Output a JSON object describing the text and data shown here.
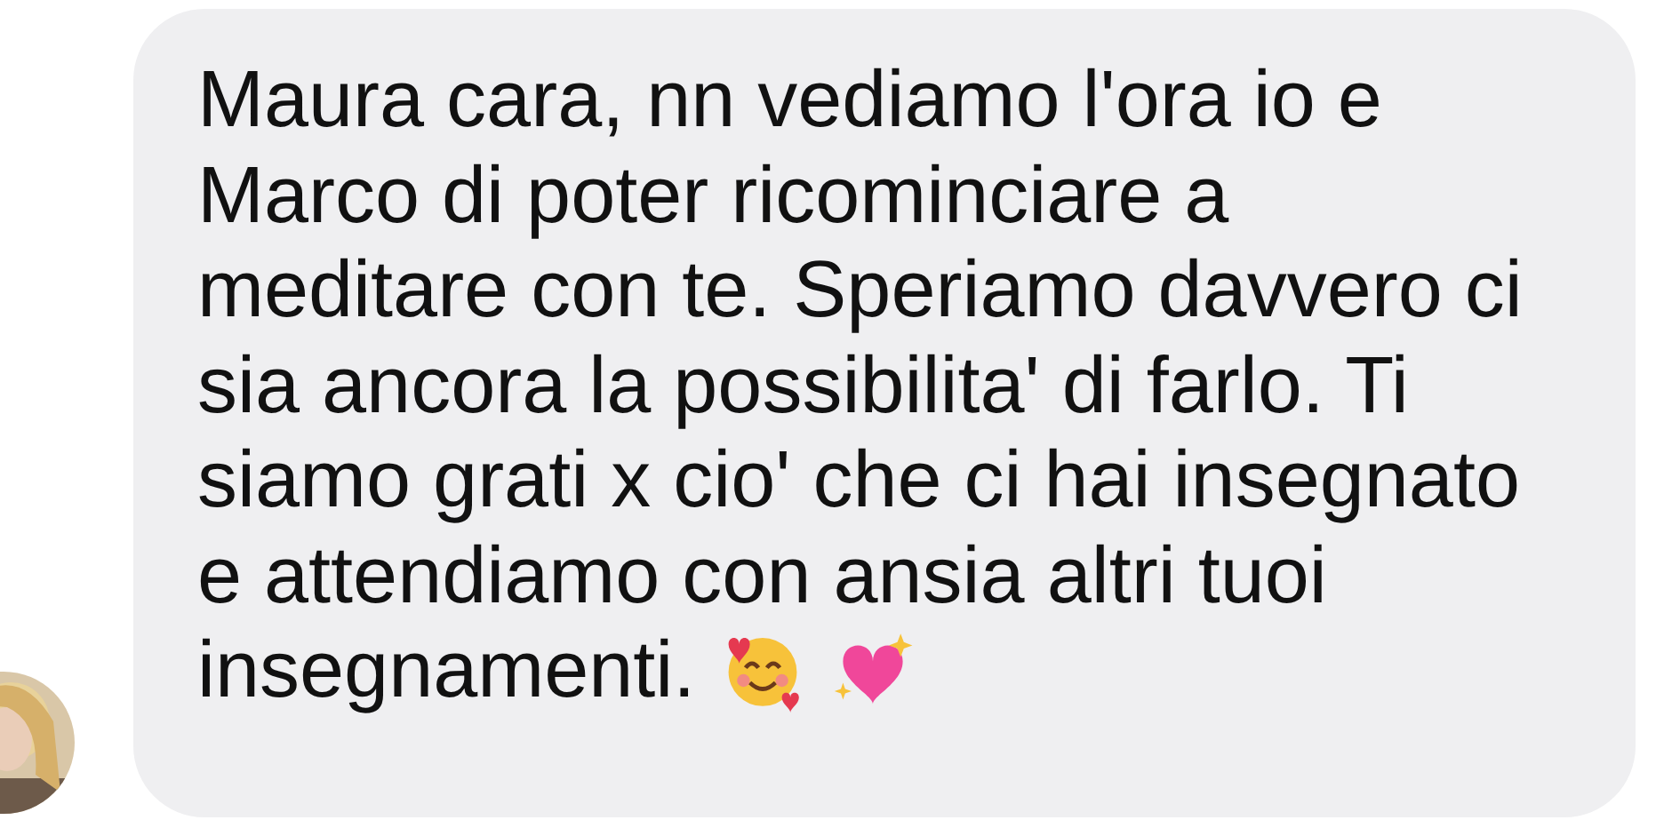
{
  "message": {
    "text": "Maura cara, nn vediamo l'ora io e\nMarco di poter ricominciare a\nmeditare con te. Speriamo davvero ci\nsia ancora la possibilita' di farlo. Ti\nsiamo grati x cio' che ci hai insegnato\ne attendiamo con ansia altri tuoi",
    "last_line": "insegnamenti."
  }
}
